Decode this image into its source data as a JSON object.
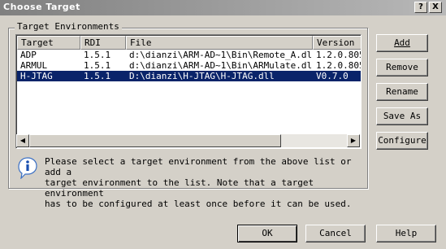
{
  "window": {
    "title": "Choose Target",
    "help_glyph": "?",
    "close_glyph": "X"
  },
  "group": {
    "label": "Target Environments"
  },
  "list": {
    "columns": [
      "Target",
      "RDI",
      "File",
      "Version"
    ],
    "rows": [
      {
        "target": "ADP",
        "rdi": "1.5.1",
        "file": "d:\\dianzi\\ARM-AD~1\\Bin\\Remote_A.dll",
        "version": "1.2.0.805"
      },
      {
        "target": "ARMUL",
        "rdi": "1.5.1",
        "file": "d:\\dianzi\\ARM-AD~1\\Bin\\ARMulate.dll",
        "version": "1.2.0.805"
      },
      {
        "target": "H-JTAG",
        "rdi": "1.5.1",
        "file": "D:\\dianzi\\H-JTAG\\H-JTAG.dll",
        "version": "V0.7.0"
      }
    ],
    "selected_index": 2
  },
  "info": {
    "message": "Please select a target environment from the above list or add a\ntarget environment to the list. Note that a target environment\nhas to be configured at least once before it can be used."
  },
  "buttons": {
    "add": "Add",
    "remove": "Remove",
    "rename": "Rename",
    "save_as": "Save As",
    "configure": "Configure",
    "ok": "OK",
    "cancel": "Cancel",
    "help": "Help"
  },
  "colors": {
    "selection": "#0a246a",
    "face": "#d4d0c8"
  }
}
